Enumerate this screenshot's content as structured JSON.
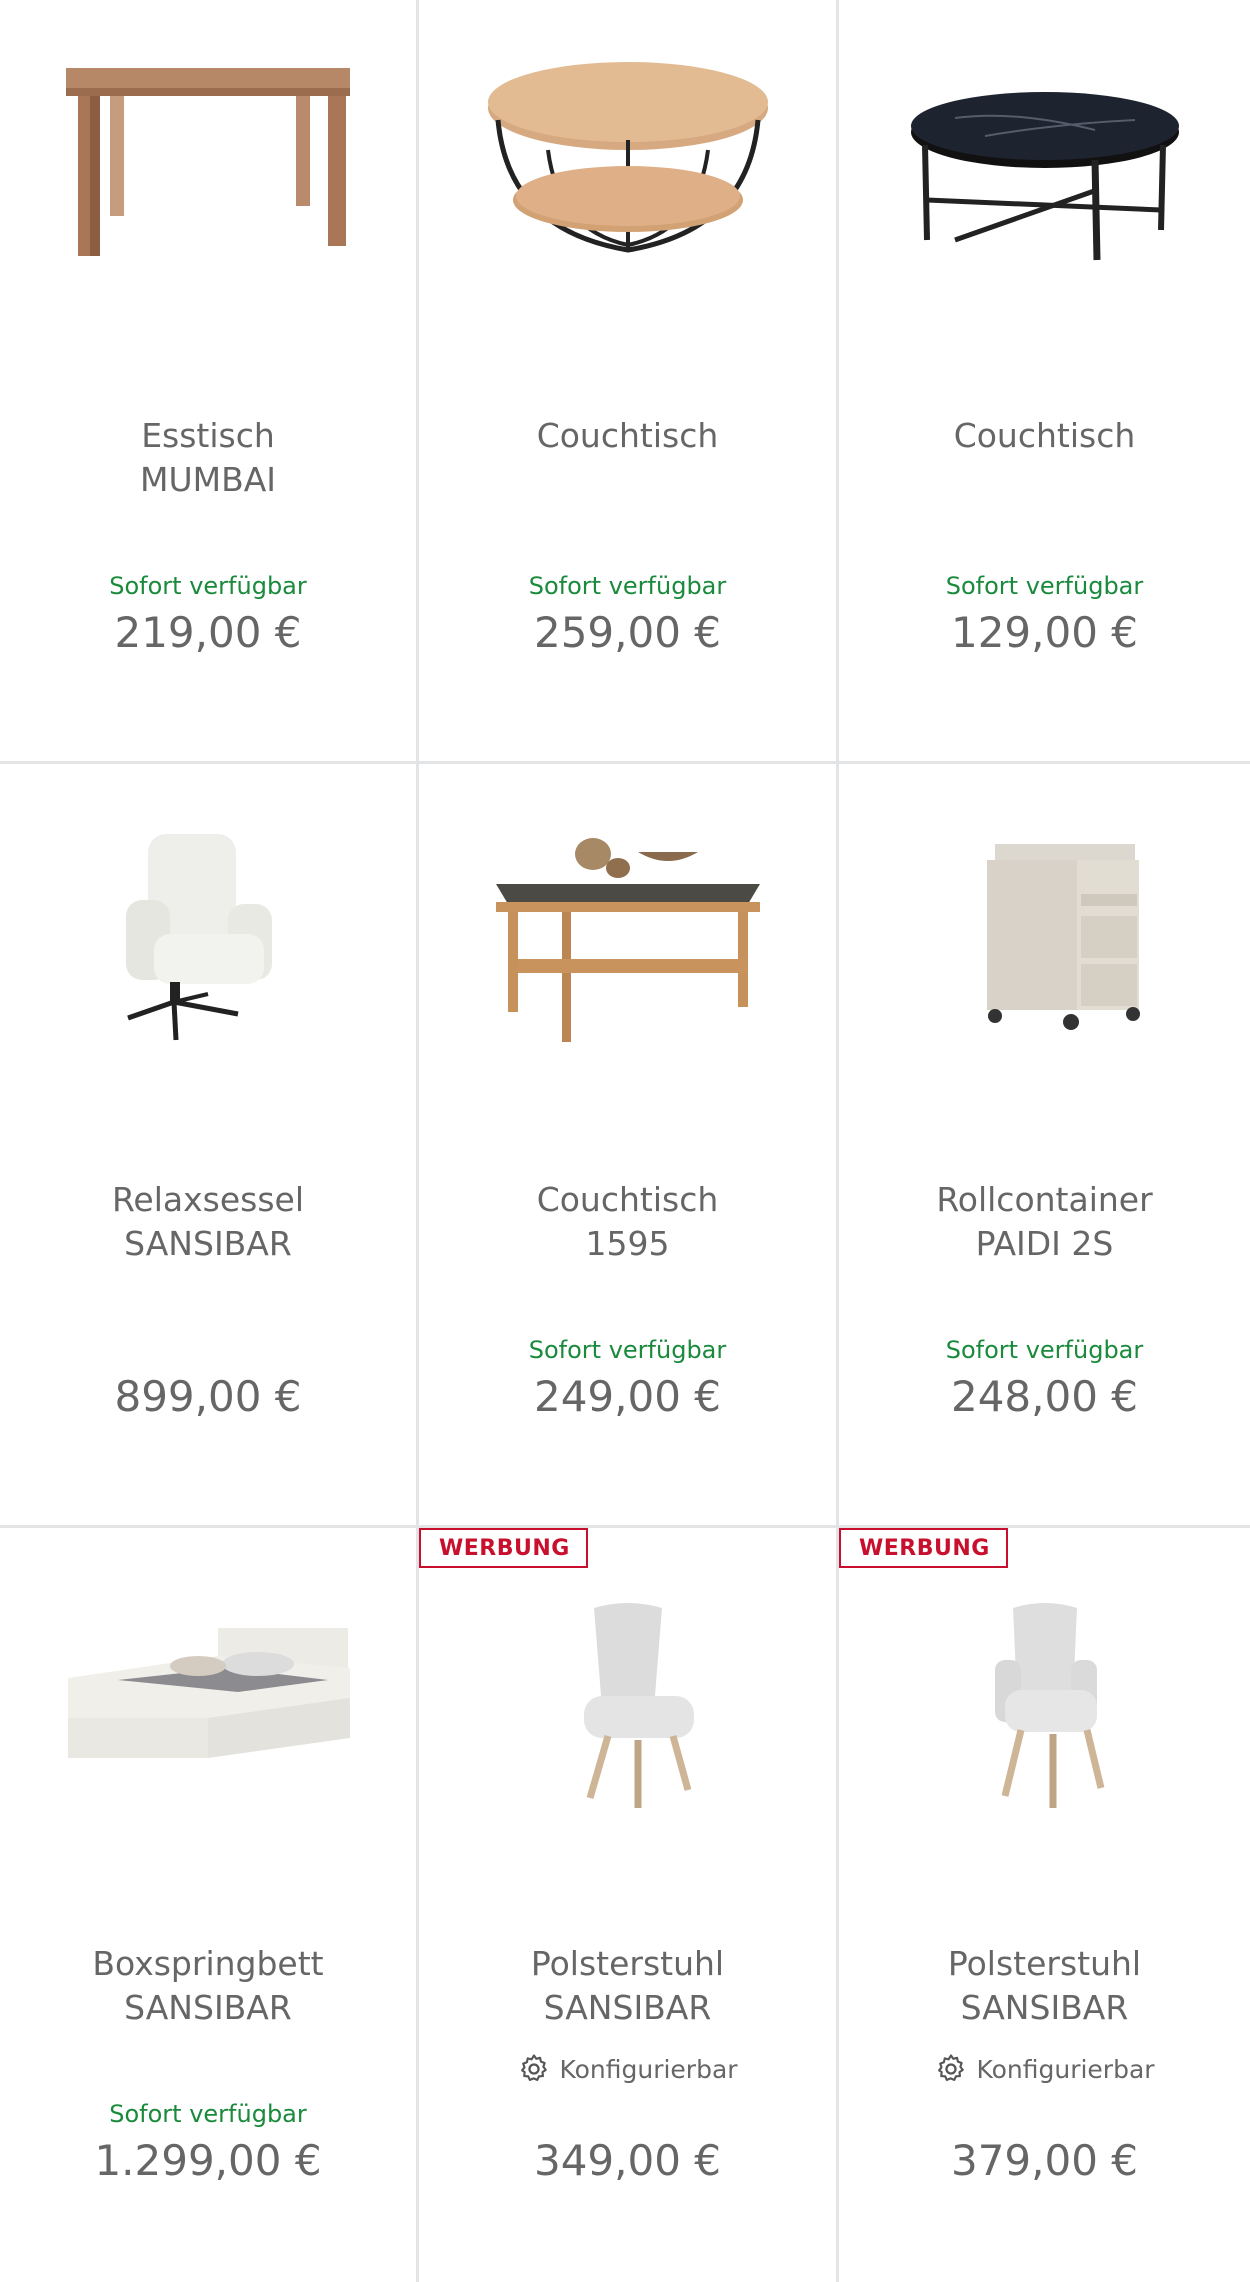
{
  "products": [
    {
      "title1": "Esstisch",
      "title2": "MUMBAI",
      "availability": "Sofort verfügbar",
      "price": "219,00 €",
      "badge": "",
      "config": "",
      "image": "console-table"
    },
    {
      "title1": "Couchtisch",
      "title2": "",
      "availability": "Sofort verfügbar",
      "price": "259,00 €",
      "badge": "",
      "config": "",
      "image": "round-coffee-table-wood"
    },
    {
      "title1": "Couchtisch",
      "title2": "",
      "availability": "Sofort verfügbar",
      "price": "129,00 €",
      "badge": "",
      "config": "",
      "image": "round-coffee-table-marble"
    },
    {
      "title1": "Relaxsessel",
      "title2": "SANSIBAR",
      "availability": "",
      "price": "899,00 €",
      "badge": "",
      "config": "",
      "image": "recliner-chair"
    },
    {
      "title1": "Couchtisch",
      "title2": "1595",
      "availability": "Sofort verfügbar",
      "price": "249,00 €",
      "badge": "",
      "config": "",
      "image": "rect-coffee-table"
    },
    {
      "title1": "Rollcontainer",
      "title2": "PAIDI 2S",
      "availability": "Sofort verfügbar",
      "price": "248,00 €",
      "badge": "",
      "config": "",
      "image": "rolling-cabinet"
    },
    {
      "title1": "Boxspringbett",
      "title2": "SANSIBAR",
      "availability": "Sofort verfügbar",
      "price": "1.299,00 €",
      "badge": "",
      "config": "",
      "image": "boxspring-bed"
    },
    {
      "title1": "Polsterstuhl",
      "title2": "SANSIBAR",
      "availability": "",
      "price": "349,00 €",
      "badge": "WERBUNG",
      "config": "Konfigurierbar",
      "image": "upholstered-chair"
    },
    {
      "title1": "Polsterstuhl",
      "title2": "SANSIBAR",
      "availability": "",
      "price": "379,00 €",
      "badge": "WERBUNG",
      "config": "Konfigurierbar",
      "image": "armchair"
    }
  ],
  "colors": {
    "availability": "#1a8a3c",
    "badge": "#c8102e",
    "text": "#666666",
    "divider": "#e3e4e6"
  }
}
